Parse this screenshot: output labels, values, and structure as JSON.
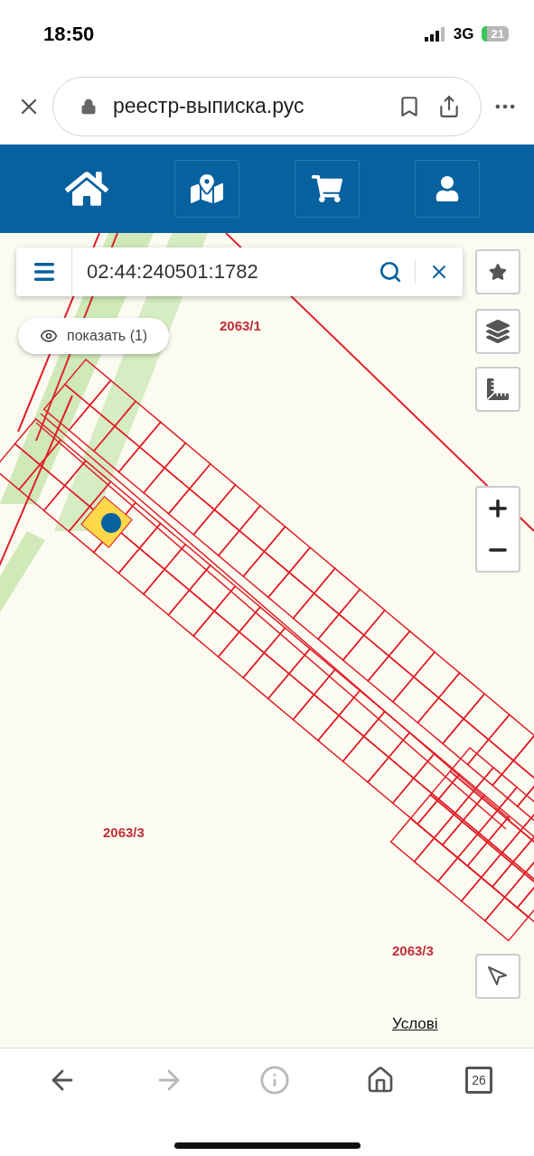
{
  "status_bar": {
    "time": "18:50",
    "network": "3G",
    "battery": "21"
  },
  "browser": {
    "url": "реестр-выписка.рус",
    "tab_count": "26"
  },
  "nav": [
    {
      "kind": "home",
      "framed": false
    },
    {
      "kind": "map",
      "framed": true
    },
    {
      "kind": "cart",
      "framed": true
    },
    {
      "kind": "user",
      "framed": true
    }
  ],
  "search": {
    "value": "02:44:240501:1782"
  },
  "show_button": {
    "label": "показать (1)"
  },
  "map_labels": [
    {
      "text": "2063/1",
      "kind": "area"
    },
    {
      "text": "2063/3",
      "kind": "area"
    },
    {
      "text": "2063/3",
      "kind": "area"
    },
    {
      "text": "Услові",
      "kind": "link"
    }
  ],
  "toolbar": [
    {
      "kind": "back",
      "disabled": false
    },
    {
      "kind": "forward",
      "disabled": true
    },
    {
      "kind": "info",
      "disabled": true
    },
    {
      "kind": "home",
      "disabled": false
    },
    {
      "kind": "tabs",
      "disabled": false
    }
  ]
}
